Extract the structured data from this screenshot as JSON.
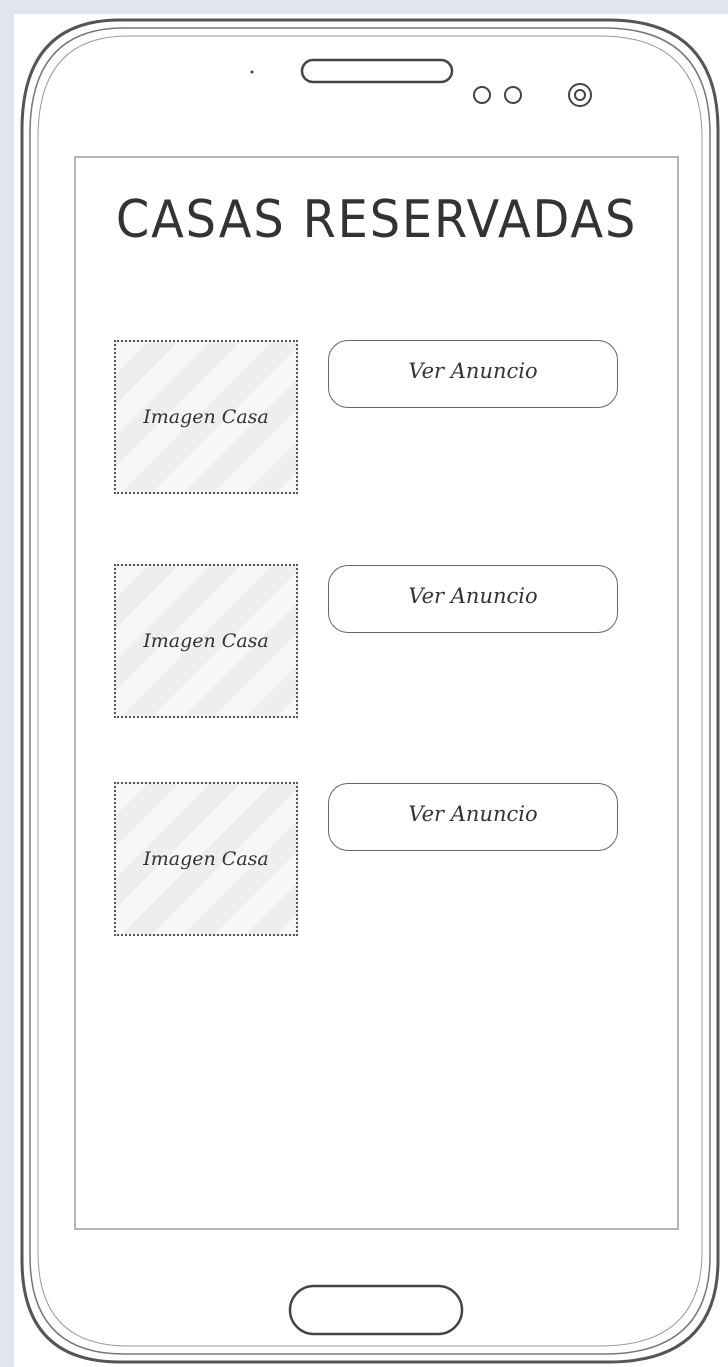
{
  "title": "CASAS RESERVADAS",
  "listings": [
    {
      "image_label": "Imagen Casa",
      "button_label": "Ver Anuncio"
    },
    {
      "image_label": "Imagen Casa",
      "button_label": "Ver Anuncio"
    },
    {
      "image_label": "Imagen Casa",
      "button_label": "Ver Anuncio"
    }
  ],
  "colors": {
    "outline": "#555555",
    "background": "#dfe6ef",
    "text": "#333333"
  }
}
